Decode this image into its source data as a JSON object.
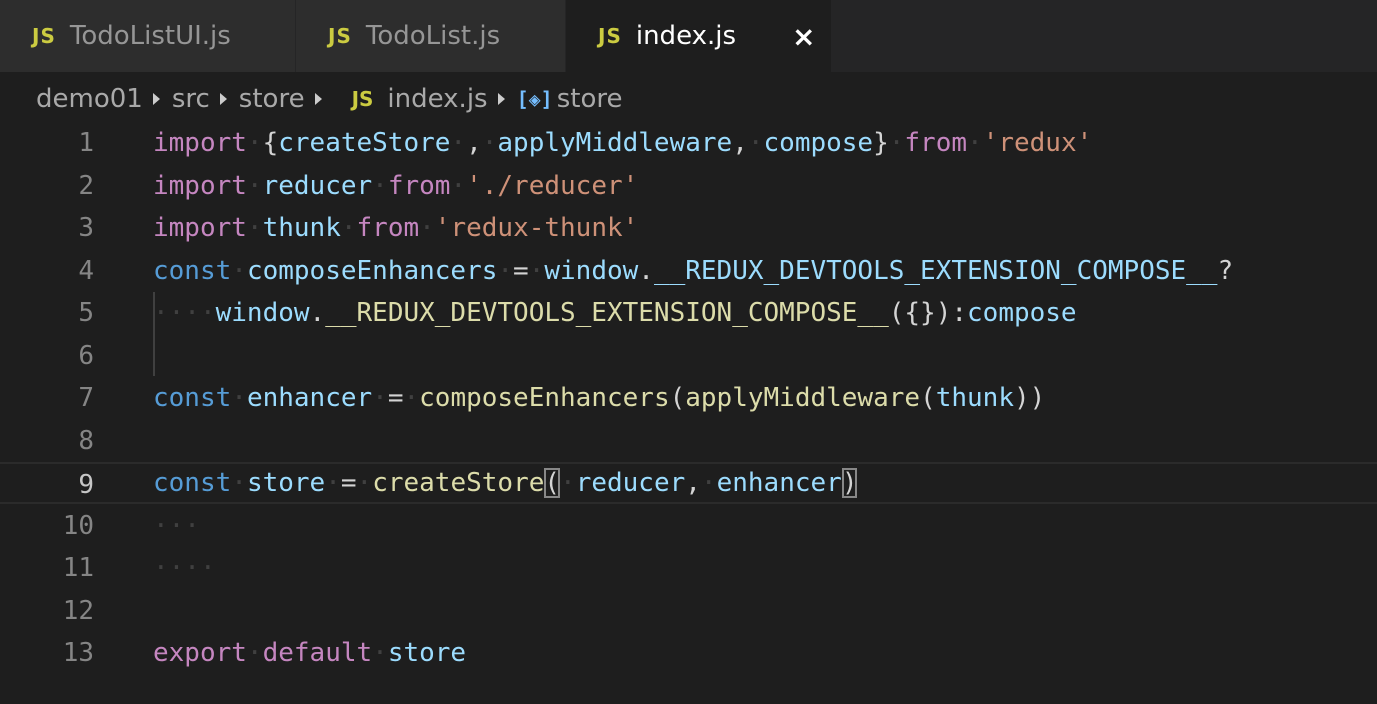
{
  "tabs": [
    {
      "icon": "JS",
      "label": "TodoListUI.js"
    },
    {
      "icon": "JS",
      "label": "TodoList.js"
    },
    {
      "icon": "JS",
      "label": "index.js",
      "close": "×"
    }
  ],
  "breadcrumb": {
    "items": [
      "demo01",
      "src",
      "store"
    ],
    "file_icon": "JS",
    "file": "index.js",
    "symbol_icon": "[◈]",
    "symbol": "store"
  },
  "editor": {
    "line_numbers": [
      "1",
      "2",
      "3",
      "4",
      "5",
      "6",
      "7",
      "8",
      "9",
      "10",
      "11",
      "12",
      "13"
    ],
    "lines": [
      [
        [
          "kw",
          "import"
        ],
        [
          "ws",
          "·"
        ],
        [
          "op",
          "{"
        ],
        [
          "var",
          "createStore"
        ],
        [
          "ws",
          "·"
        ],
        [
          "op",
          ","
        ],
        [
          "ws",
          "·"
        ],
        [
          "var",
          "applyMiddleware"
        ],
        [
          "op",
          ","
        ],
        [
          "ws",
          "·"
        ],
        [
          "var",
          "compose"
        ],
        [
          "op",
          "}"
        ],
        [
          "ws",
          "·"
        ],
        [
          "kw",
          "from"
        ],
        [
          "ws",
          "·"
        ],
        [
          "str",
          "'redux'"
        ]
      ],
      [
        [
          "kw",
          "import"
        ],
        [
          "ws",
          "·"
        ],
        [
          "var",
          "reducer"
        ],
        [
          "ws",
          "·"
        ],
        [
          "kw",
          "from"
        ],
        [
          "ws",
          "·"
        ],
        [
          "str",
          "'./reducer'"
        ]
      ],
      [
        [
          "kw",
          "import"
        ],
        [
          "ws",
          "·"
        ],
        [
          "var",
          "thunk"
        ],
        [
          "ws",
          "·"
        ],
        [
          "kw",
          "from"
        ],
        [
          "ws",
          "·"
        ],
        [
          "str",
          "'redux-thunk'"
        ]
      ],
      [
        [
          "st",
          "const"
        ],
        [
          "ws",
          "·"
        ],
        [
          "var",
          "composeEnhancers"
        ],
        [
          "ws",
          "·"
        ],
        [
          "op",
          "="
        ],
        [
          "ws",
          "·"
        ],
        [
          "var",
          "window"
        ],
        [
          "op",
          "."
        ],
        [
          "var",
          "__REDUX_DEVTOOLS_EXTENSION_COMPOSE__"
        ],
        [
          "op",
          "?"
        ]
      ],
      [
        [
          "ws",
          "···"
        ],
        [
          "ws",
          "·"
        ],
        [
          "var",
          "window"
        ],
        [
          "op",
          "."
        ],
        [
          "fn",
          "__REDUX_DEVTOOLS_EXTENSION_COMPOSE__"
        ],
        [
          "op",
          "({}):"
        ],
        [
          "var",
          "compose"
        ]
      ],
      [],
      [
        [
          "st",
          "const"
        ],
        [
          "ws",
          "·"
        ],
        [
          "var",
          "enhancer"
        ],
        [
          "ws",
          "·"
        ],
        [
          "op",
          "="
        ],
        [
          "ws",
          "·"
        ],
        [
          "fn",
          "composeEnhancers"
        ],
        [
          "op",
          "("
        ],
        [
          "fn",
          "applyMiddleware"
        ],
        [
          "op",
          "("
        ],
        [
          "var",
          "thunk"
        ],
        [
          "op",
          "))"
        ]
      ],
      [],
      [
        [
          "st",
          "const"
        ],
        [
          "ws",
          "·"
        ],
        [
          "var",
          "store"
        ],
        [
          "ws",
          "·"
        ],
        [
          "op",
          "="
        ],
        [
          "ws",
          "·"
        ],
        [
          "fn",
          "createStore"
        ],
        [
          "brk",
          "("
        ],
        [
          "ws",
          "·"
        ],
        [
          "var",
          "reducer"
        ],
        [
          "op",
          ","
        ],
        [
          "ws",
          "·"
        ],
        [
          "var",
          "enhancer"
        ],
        [
          "brk",
          ")"
        ]
      ],
      [
        [
          "ws",
          "···"
        ]
      ],
      [
        [
          "ws",
          "····"
        ]
      ],
      [],
      [
        [
          "kw",
          "export"
        ],
        [
          "ws",
          "·"
        ],
        [
          "kw",
          "default"
        ],
        [
          "ws",
          "·"
        ],
        [
          "var",
          "store"
        ]
      ]
    ],
    "current_line": 9
  }
}
